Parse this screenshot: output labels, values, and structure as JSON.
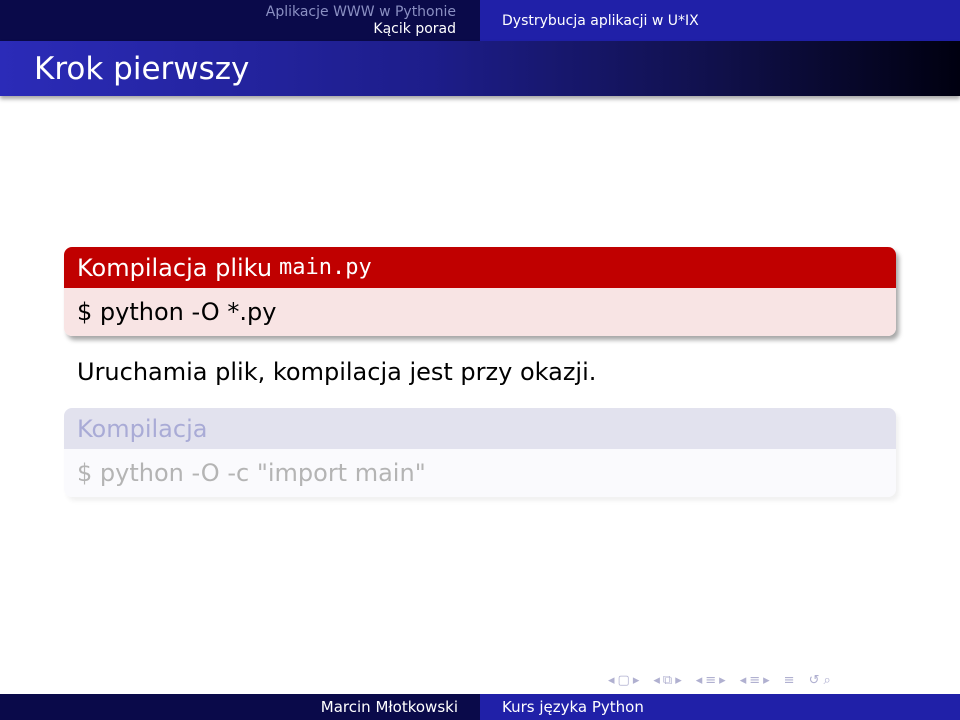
{
  "header": {
    "section": "Aplikacje WWW w Pythonie",
    "subsection": "Kącik porad",
    "right_title": "Dystrybucja aplikacji w U*IX"
  },
  "frame": {
    "title": "Krok pierwszy"
  },
  "block_active": {
    "title": "Kompilacja pliku",
    "title_code": "main.py",
    "body": "$ python -O *.py"
  },
  "paragraph": "Uruchamia plik, kompilacja jest przy okazji.",
  "block_inactive": {
    "title": "Kompilacja",
    "body": "$ python -O -c \"import main\""
  },
  "nav_icons": [
    "prev-frame-icon",
    "frame-icon",
    "next-frame-icon",
    "prev-subsection-icon",
    "subsection-icon",
    "next-subsection-icon",
    "prev-section-icon",
    "section-icon",
    "next-section-icon",
    "align-icon",
    "back-icon",
    "search-icon"
  ],
  "footer": {
    "author": "Marcin Młotkowski",
    "course": "Kurs języka Python"
  },
  "colors": {
    "header_dark": "#0a0a4a",
    "header_blue": "#2020a8",
    "block_red": "#c00000",
    "block_red_body": "#f8e4e4"
  }
}
